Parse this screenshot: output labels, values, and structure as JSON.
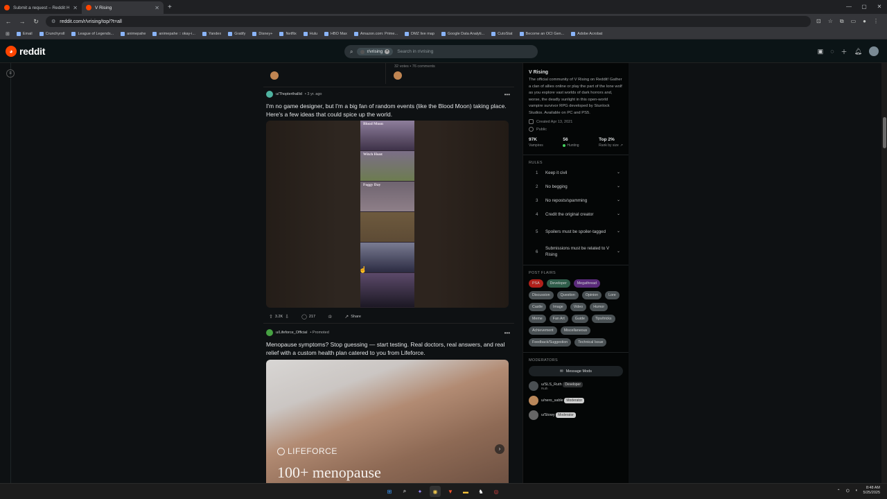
{
  "browser": {
    "tabs": [
      {
        "label": "Submit a request – Reddit Help",
        "active": false
      },
      {
        "label": "V Rising",
        "active": true
      }
    ],
    "url": "reddit.com/r/vrising/top/?t=all",
    "bookmarks": [
      "Email",
      "Crunchyroll",
      "League of Legends...",
      "animepahe",
      "animepahe :: okay-i...",
      "Yandex",
      "Gratify",
      "Disney+",
      "Netflix",
      "Hulu",
      "HBO Max",
      "Amazon.com: Prime...",
      "DMZ live map",
      "Google Data Analyti...",
      "CutoStat",
      "Become an OCI Gen...",
      "Adobe Acrobat"
    ]
  },
  "header": {
    "logo_text": "reddit",
    "search_chip": "r/vrising",
    "search_placeholder": "Search in r/vrising"
  },
  "feed": {
    "crosspost_meta": "32 votes • 76 comments",
    "post1": {
      "user": "u/Thopterthallid",
      "time": "• 3 yr. ago",
      "title": "I'm no game designer, but I'm a big fan of random events (like the Blood Moon) taking place. Here's a few ideas that could spice up the world.",
      "panels": [
        "Blood Moon",
        "Witch Hunt",
        "Foggy Day",
        "",
        "",
        ""
      ],
      "votes": "3.2K",
      "comments": "217",
      "share": "Share"
    },
    "post2": {
      "user": "u/Lifeforce_Official",
      "promoted": "• Promoted",
      "title": "Menopause symptoms? Stop guessing — start testing. Real doctors, real answers, and real relief with a custom health plan catered to you from Lifeforce.",
      "brand": "LIFEFORCE",
      "headline": "100+ menopause"
    }
  },
  "sidebar": {
    "title": "V Rising",
    "description": "The official community of V Rising on Reddit! Gather a clan of allies online or play the part of the lone wolf as you explore vast worlds of dark horrors and, worse, the deadly sunlight in this open-world vampire survivor RPG developed by Stunlock Studios. Available on PC and PS5.",
    "created": "Created Apr 13, 2021",
    "visibility": "Public",
    "stats": [
      {
        "value": "97K",
        "label": "Vampires"
      },
      {
        "value": "56",
        "label": "Hunting"
      },
      {
        "value": "Top 2%",
        "label": "Rank by size"
      }
    ],
    "rules_heading": "RULES",
    "rules": [
      {
        "num": "1",
        "text": "Keep it civil"
      },
      {
        "num": "2",
        "text": "No begging"
      },
      {
        "num": "3",
        "text": "No reposts/spamming"
      },
      {
        "num": "4",
        "text": "Credit the original creator"
      },
      {
        "num": "5",
        "text": "Spoilers must be spoiler-tagged"
      },
      {
        "num": "6",
        "text": "Submissions must be related to V Rising"
      }
    ],
    "flairs_heading": "POST FLAIRS",
    "flairs": [
      {
        "label": "PSA",
        "color": "#b0201a"
      },
      {
        "label": "Developer",
        "color": "#2f5d4a"
      },
      {
        "label": "Megathread",
        "color": "#5a2a7a"
      },
      {
        "label": "Discussion",
        "color": "#4a5154"
      },
      {
        "label": "Question",
        "color": "#4a5154"
      },
      {
        "label": "Opinion",
        "color": "#4a5154"
      },
      {
        "label": "Lore",
        "color": "#4a5154"
      },
      {
        "label": "Castle",
        "color": "#4a5154"
      },
      {
        "label": "Image",
        "color": "#4a5154"
      },
      {
        "label": "Video",
        "color": "#4a5154"
      },
      {
        "label": "Humor",
        "color": "#4a5154"
      },
      {
        "label": "Meme",
        "color": "#4a5154"
      },
      {
        "label": "Fan Art",
        "color": "#4a5154"
      },
      {
        "label": "Guide",
        "color": "#4a5154"
      },
      {
        "label": "Tips/tricks",
        "color": "#4a5154"
      },
      {
        "label": "Achievement",
        "color": "#4a5154"
      },
      {
        "label": "Miscellaneous",
        "color": "#4a5154"
      },
      {
        "label": "Feedback/Suggestion",
        "color": "#4a5154"
      },
      {
        "label": "Technical Issue",
        "color": "#4a5154"
      }
    ],
    "moderators_heading": "MODERATORS",
    "message_mods": "Message Mods",
    "mods": [
      {
        "name": "u/SLS_Ruth",
        "badge": "Developer",
        "sub": "Ruth"
      },
      {
        "name": "u/nero_sable",
        "badge": "Moderator",
        "sub": ""
      },
      {
        "name": "u/Stowy",
        "badge": "Moderator",
        "sub": ""
      }
    ]
  },
  "taskbar": {
    "time": "8:48 AM",
    "date": "5/25/2025"
  }
}
